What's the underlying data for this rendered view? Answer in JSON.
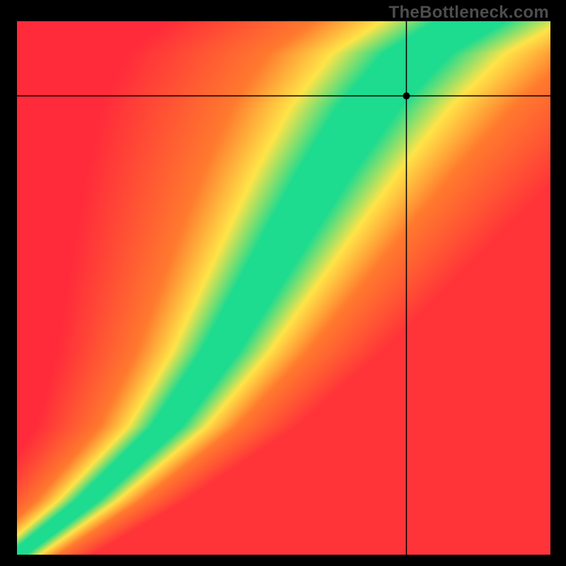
{
  "watermark": "TheBottleneck.com",
  "chart_data": {
    "type": "heatmap",
    "title": "",
    "xlabel": "",
    "ylabel": "",
    "xlim": [
      0,
      100
    ],
    "ylim": [
      0,
      100
    ],
    "values_description": "Smooth gradient field from red (poor match) through orange/yellow to green (optimal match). A green optimal band curves from bottom-left corner upward through approximately (45,50) to top-center/top-right, flanked by yellow transition zones and red/orange elsewhere.",
    "crosshair": {
      "x": 73,
      "y": 86
    },
    "marker_point": {
      "x": 73,
      "y": 86
    },
    "optimal_band_anchors": [
      {
        "x": 0,
        "y": 0
      },
      {
        "x": 13,
        "y": 10
      },
      {
        "x": 28,
        "y": 24
      },
      {
        "x": 38,
        "y": 38
      },
      {
        "x": 45,
        "y": 50
      },
      {
        "x": 52,
        "y": 62
      },
      {
        "x": 58,
        "y": 72
      },
      {
        "x": 66,
        "y": 84
      },
      {
        "x": 75,
        "y": 94
      },
      {
        "x": 85,
        "y": 100
      }
    ],
    "color_legend": {
      "red": "#ff2b3a",
      "orange": "#ff7a2e",
      "yellow": "#ffe448",
      "green": "#1ddb8f"
    }
  }
}
